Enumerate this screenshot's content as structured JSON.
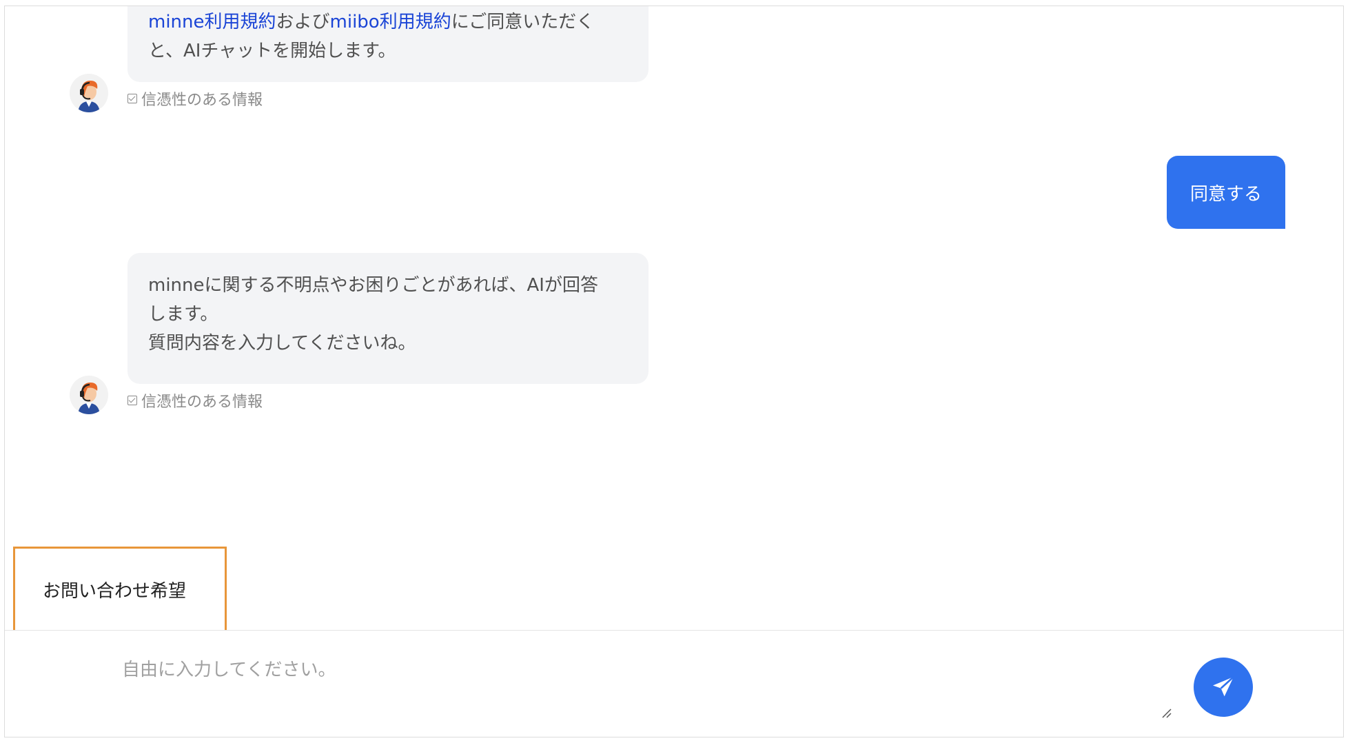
{
  "messages": [
    {
      "role": "bot",
      "segments_line1": [
        {
          "text": "minne利用規約",
          "link": true
        },
        {
          "text": "および",
          "link": false
        },
        {
          "text": "miibo利用規約",
          "link": true
        },
        {
          "text": "にご同意いただく",
          "link": false
        }
      ],
      "line2": "と、AIチャットを開始します。",
      "credibility": "信憑性のある情報"
    },
    {
      "role": "user",
      "text": "同意する"
    },
    {
      "role": "bot",
      "lines": [
        "minneに関する不明点やお困りごとがあれば、AIが回答",
        "します。",
        "質問内容を入力してくださいね。"
      ],
      "credibility": "信憑性のある情報"
    }
  ],
  "quick_reply": {
    "label": "お問い合わせ希望"
  },
  "input": {
    "placeholder": "自由に入力してください。",
    "value": ""
  },
  "icons": {
    "avatar": "support-agent-avatar-icon",
    "credibility": "check-box-icon",
    "send": "paper-plane-send-icon"
  },
  "colors": {
    "accent": "#2f72ee",
    "link": "#1a44d6",
    "bot_bubble": "#f3f4f6",
    "highlight_border": "#e8963a"
  }
}
